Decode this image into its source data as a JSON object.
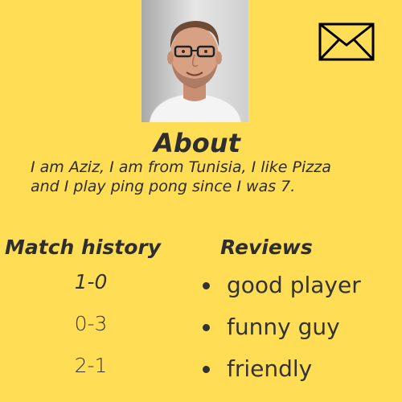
{
  "profile": {
    "photo_icon": "profile-photo",
    "contact_icon": "mail-icon"
  },
  "about": {
    "title": "About",
    "text": "I am Aziz, I am from Tunisia, I like Pizza and I play ping pong since I was 7."
  },
  "match_history": {
    "title": "Match history",
    "scores": [
      "1-0",
      "0-3",
      "2-1"
    ]
  },
  "reviews": {
    "title": "Reviews",
    "items": [
      "good player",
      "funny guy",
      "friendly"
    ]
  },
  "colors": {
    "background": "#ffdd55",
    "text": "#2c2c2c"
  }
}
